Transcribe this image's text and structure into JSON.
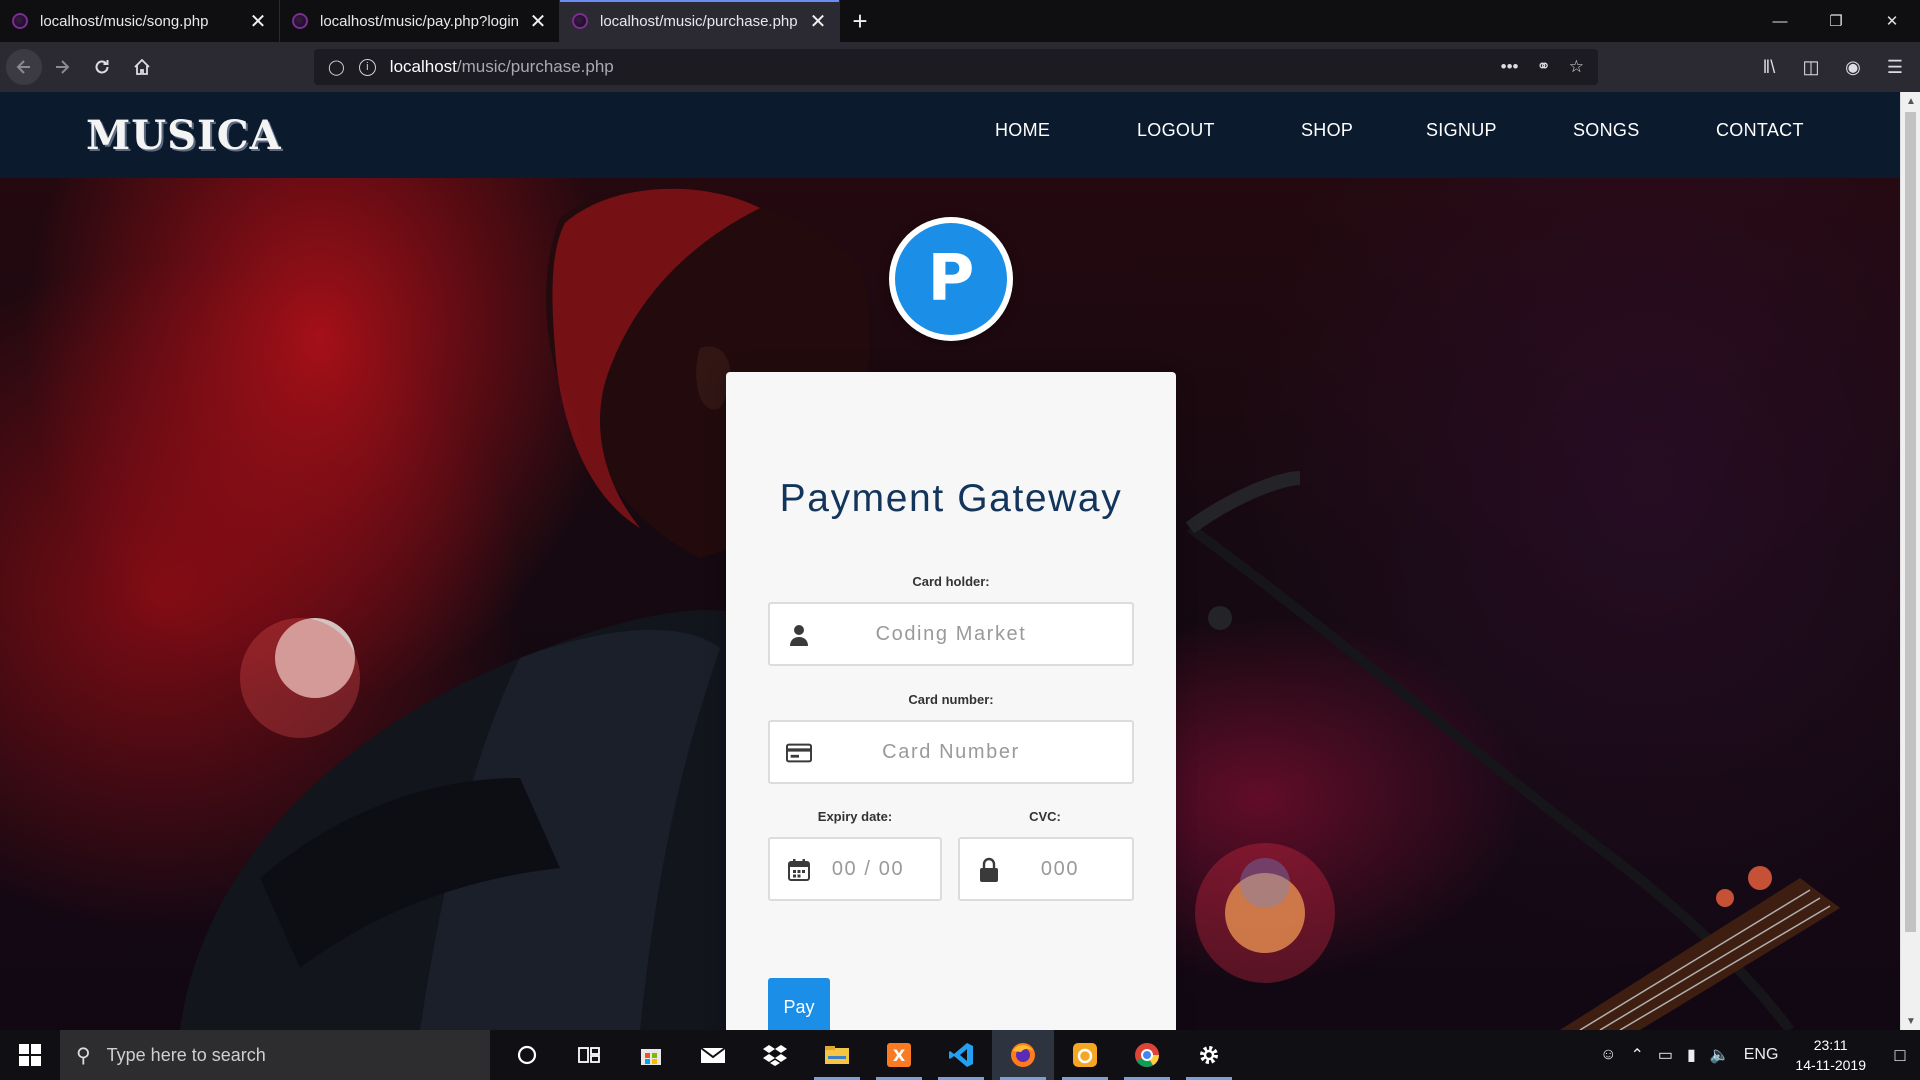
{
  "browser": {
    "tabs": [
      {
        "title": "localhost/music/song.php",
        "active": false
      },
      {
        "title": "localhost/music/pay.php?login",
        "active": false
      },
      {
        "title": "localhost/music/purchase.php",
        "active": true
      }
    ],
    "url_host": "localhost",
    "url_path": "/music/purchase.php"
  },
  "site": {
    "logo": "MUSICA",
    "nav": [
      "HOME",
      "LOGOUT",
      "SHOP",
      "SIGNUP",
      "SONGS",
      "CONTACT"
    ]
  },
  "payment": {
    "logo_letter": "P",
    "title": "Payment Gateway",
    "card_holder_label": "Card holder:",
    "card_holder_placeholder": "Coding Market",
    "card_number_label": "Card number:",
    "card_number_placeholder": "Card Number",
    "expiry_label": "Expiry date:",
    "expiry_placeholder": "00 / 00",
    "cvc_label": "CVC:",
    "cvc_placeholder": "000",
    "pay_button": "Pay"
  },
  "taskbar": {
    "search_placeholder": "Type here to search",
    "language": "ENG",
    "time": "23:11",
    "date": "14-11-2019"
  },
  "colors": {
    "header_bg": "#0c1a2e",
    "accent_blue": "#1b8ee8",
    "title_color": "#13355b"
  }
}
